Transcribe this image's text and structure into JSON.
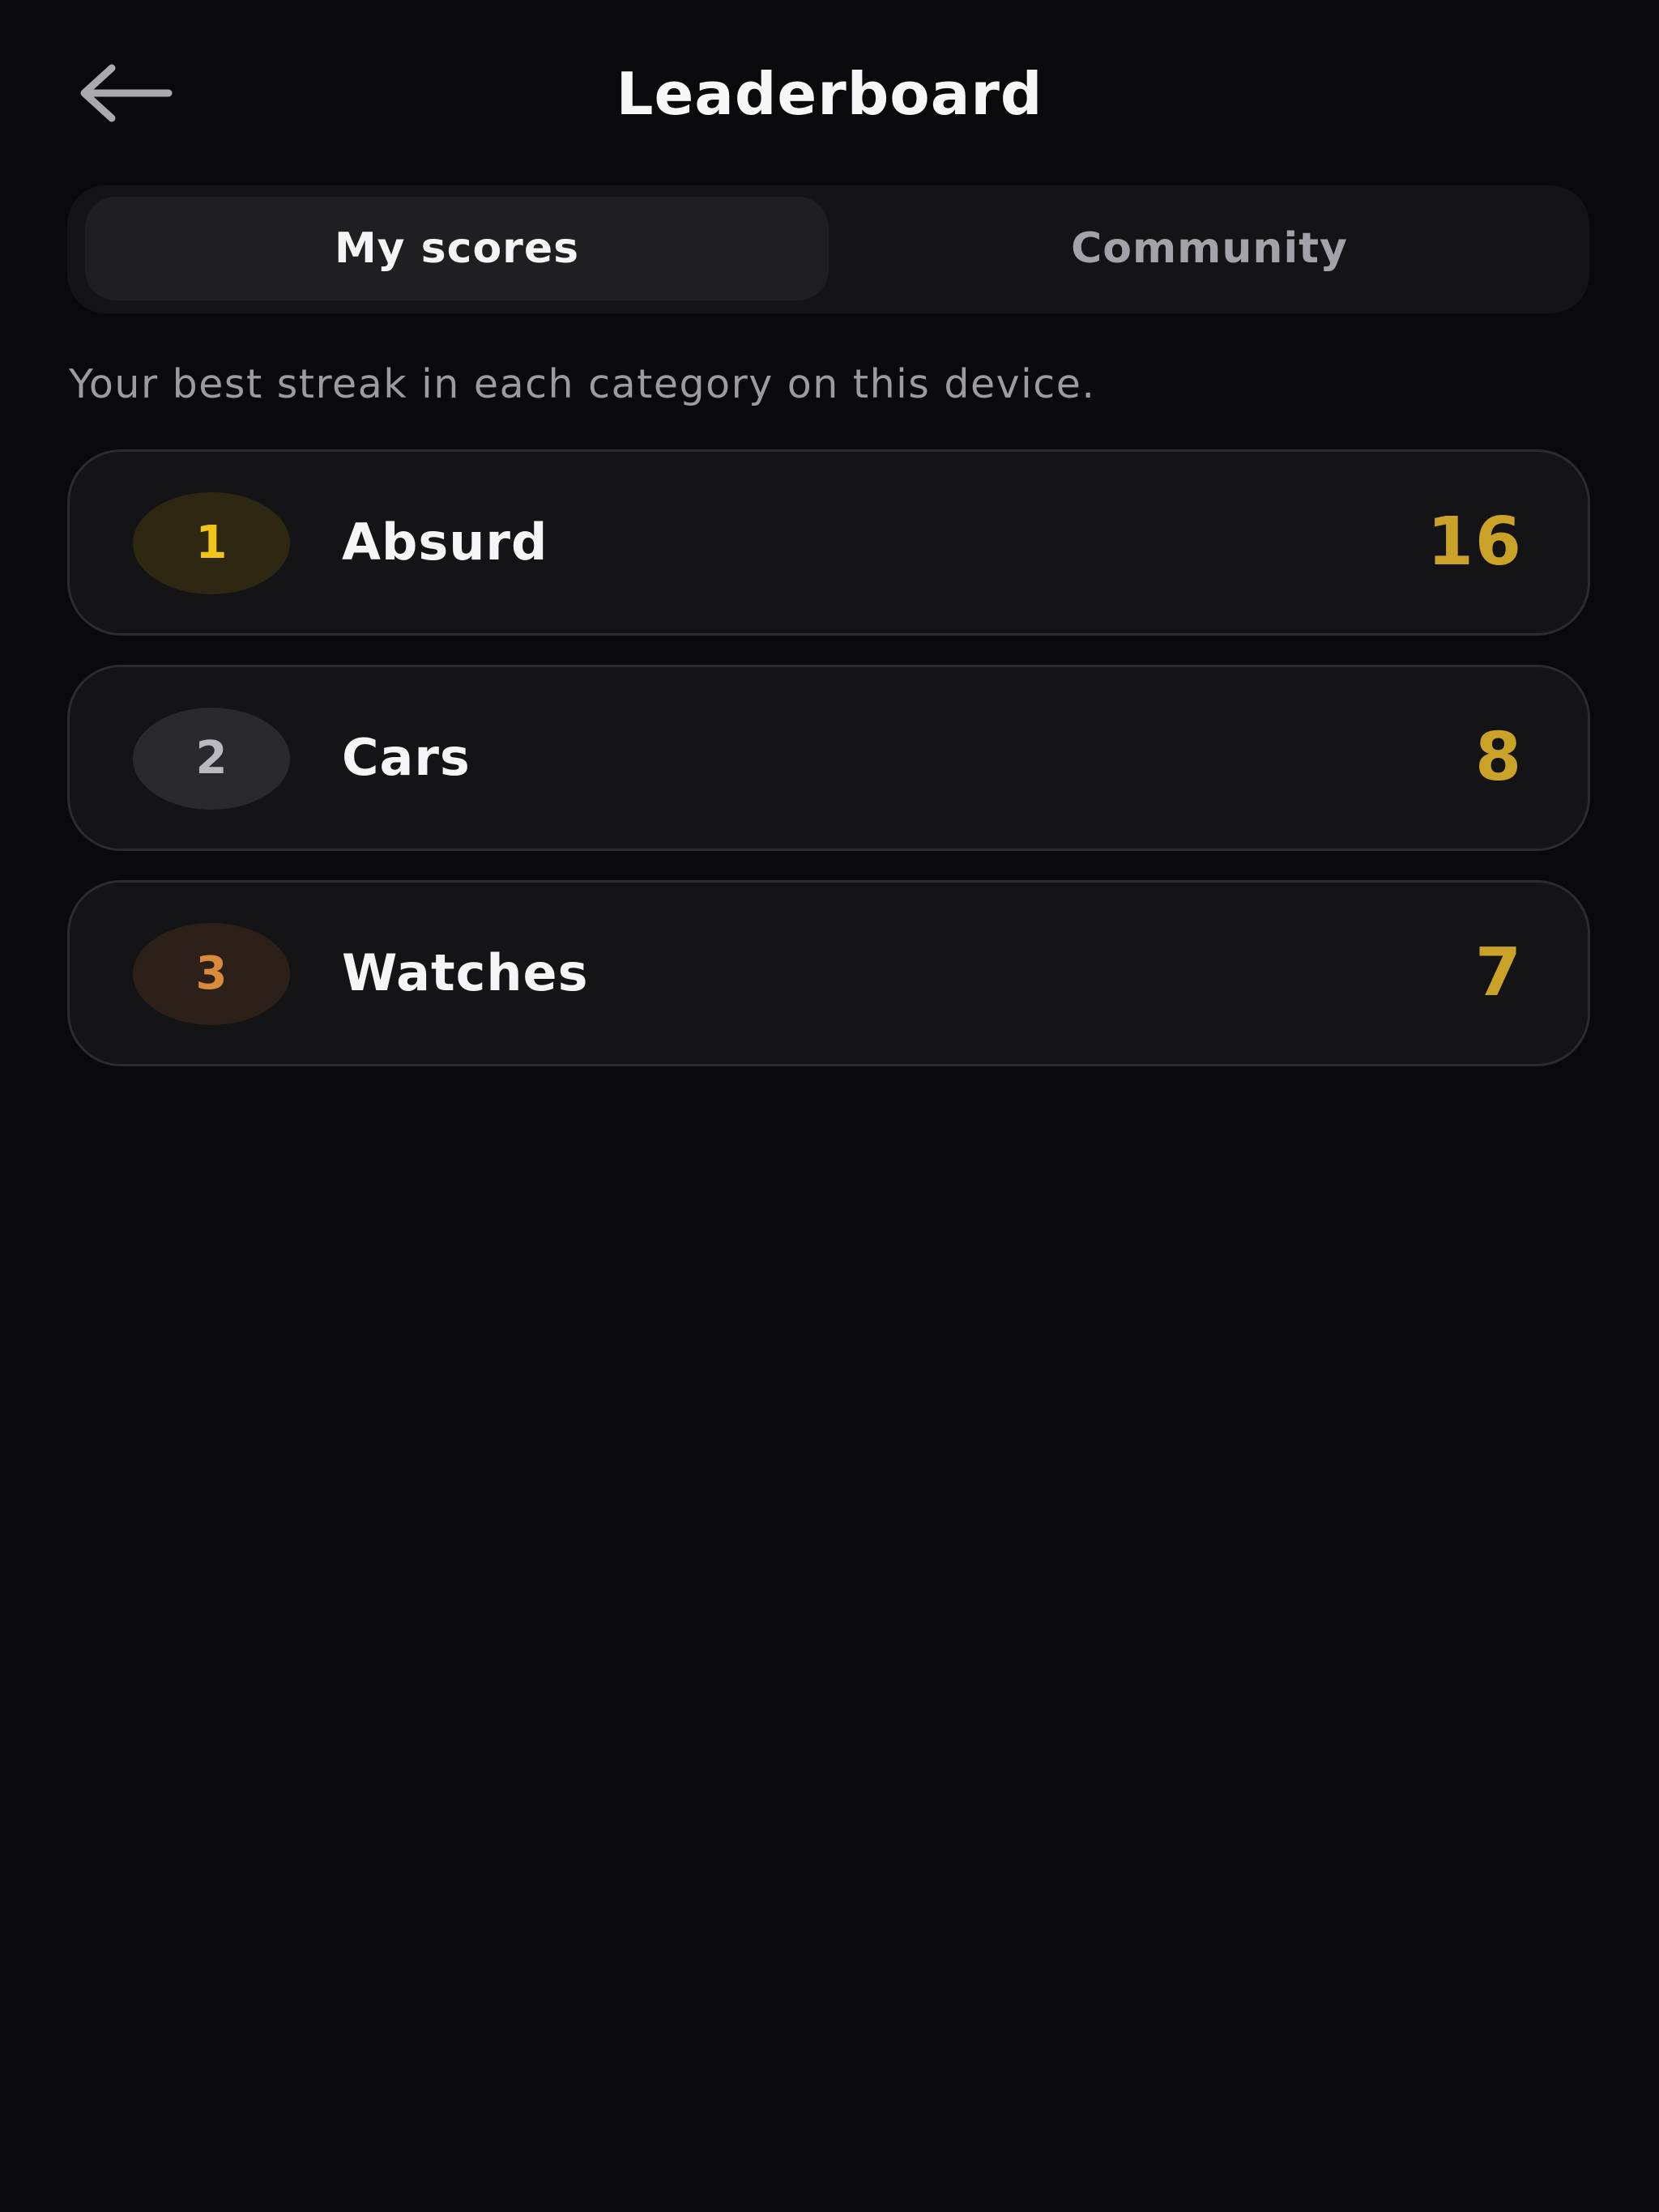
{
  "header": {
    "title": "Leaderboard",
    "back_icon": "arrow-left-icon"
  },
  "tabs": [
    {
      "label": "My scores",
      "active": true
    },
    {
      "label": "Community",
      "active": false
    }
  ],
  "subtitle": "Your best streak in each category on this device.",
  "scores": [
    {
      "rank": "1",
      "category": "Absurd",
      "score": "16"
    },
    {
      "rank": "2",
      "category": "Cars",
      "score": "8"
    },
    {
      "rank": "3",
      "category": "Watches",
      "score": "7"
    }
  ],
  "colors": {
    "background": "#0a0a0c",
    "card": "#141416",
    "score_gold": "#c9a227",
    "rank_gold": "#f0c419",
    "rank_silver": "#b9b9bf",
    "rank_bronze": "#d98a3a"
  }
}
